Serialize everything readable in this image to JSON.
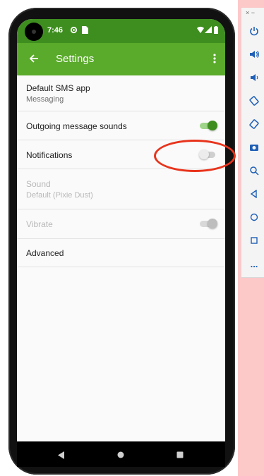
{
  "status_bar": {
    "time": "7:46"
  },
  "app_bar": {
    "title": "Settings"
  },
  "settings": {
    "default_sms": {
      "label": "Default SMS app",
      "value": "Messaging"
    },
    "outgoing_sounds": {
      "label": "Outgoing message sounds",
      "enabled": true
    },
    "notifications": {
      "label": "Notifications",
      "enabled": false
    },
    "sound": {
      "label": "Sound",
      "value": "Default (Pixie Dust)"
    },
    "vibrate": {
      "label": "Vibrate",
      "enabled": true
    },
    "advanced": {
      "label": "Advanced"
    }
  },
  "colors": {
    "status_bar": "#3e8e1f",
    "app_bar": "#5aaa2b",
    "annotation_circle": "#e8341c",
    "emulator_background": "#fcc8c8"
  },
  "emulator_toolbar": {
    "window_controls": "× −",
    "more_label": "..."
  },
  "icons": {
    "status": [
      "gear-icon",
      "sim-card-icon",
      "wifi-icon",
      "signal-icon",
      "battery-icon"
    ],
    "app_bar": [
      "back-arrow-icon",
      "more-vert-icon"
    ],
    "toolbar": [
      "power-icon",
      "volume-up-icon",
      "volume-down-icon",
      "rotate-left-icon",
      "rotate-right-icon",
      "camera-icon",
      "zoom-icon",
      "back-icon",
      "home-icon",
      "overview-icon",
      "more-icon"
    ]
  }
}
